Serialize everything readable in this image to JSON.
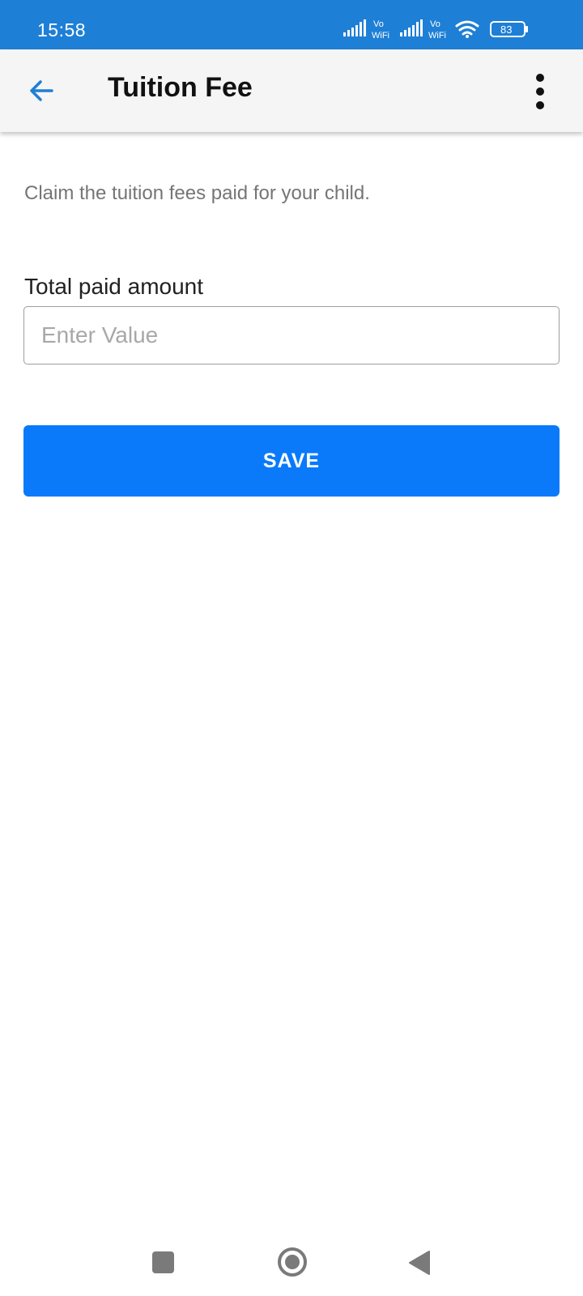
{
  "status_bar": {
    "time": "15:58",
    "sim1_label_top": "Vo",
    "sim1_label_bottom": "WiFi",
    "sim2_label_top": "Vo",
    "sim2_label_bottom": "WiFi",
    "battery": "83",
    "color": "#1e7fd6"
  },
  "app_bar": {
    "title": "Tuition Fee",
    "back_icon": "arrow-left-icon",
    "menu_icon": "more-vertical-icon",
    "accent": "#1e7fd6"
  },
  "form": {
    "description": "Claim the tuition fees paid for your child.",
    "amount_label": "Total paid amount",
    "amount_placeholder": "Enter Value",
    "amount_value": "",
    "save_label": "SAVE",
    "save_color": "#0a7afb"
  },
  "nav_bar": {
    "recents_icon": "square-recents-icon",
    "home_icon": "circle-home-icon",
    "back_icon": "triangle-back-icon"
  }
}
